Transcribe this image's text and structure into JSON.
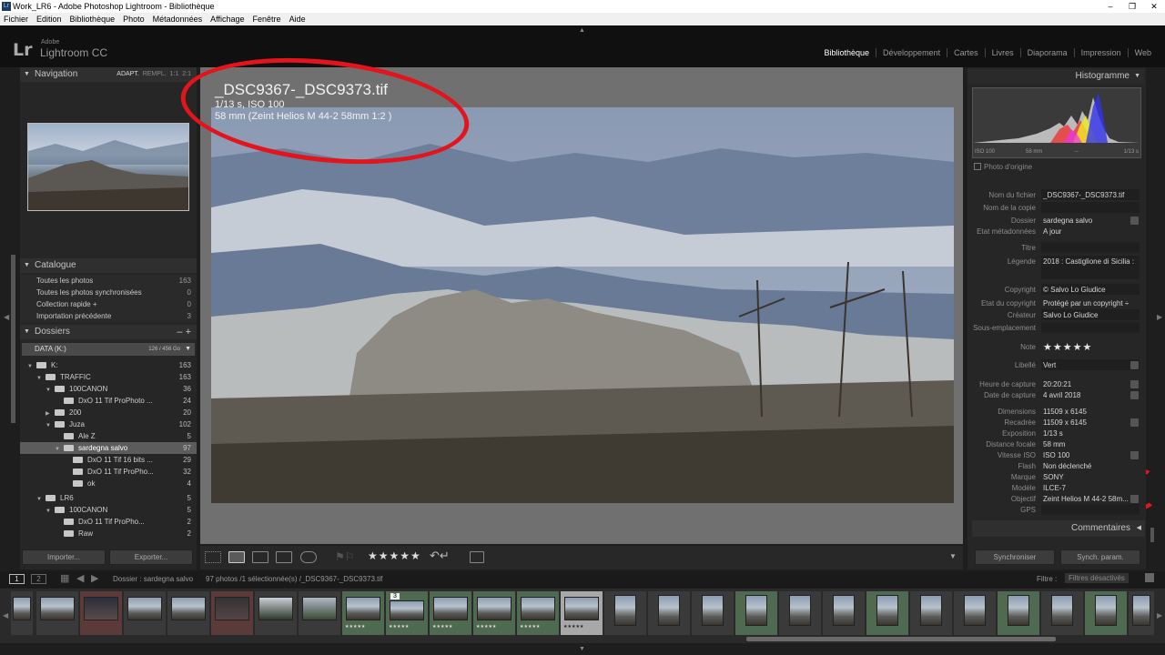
{
  "window": {
    "title": "Work_LR6 - Adobe Photoshop Lightroom - Bibliothèque",
    "controls": [
      "–",
      "❐",
      "✕"
    ]
  },
  "menu": [
    "Fichier",
    "Edition",
    "Bibliothèque",
    "Photo",
    "Métadonnées",
    "Affichage",
    "Fenêtre",
    "Aide"
  ],
  "identity": {
    "logo": "Lr",
    "adobe": "Adobe",
    "product": "Lightroom CC"
  },
  "modules": [
    "Bibliothèque",
    "Développement",
    "Cartes",
    "Livres",
    "Diaporama",
    "Impression",
    "Web"
  ],
  "active_module": "Bibliothèque",
  "navigator": {
    "title": "Navigation",
    "options": [
      "ADAPT.",
      "REMPL.",
      "1:1",
      "2:1"
    ]
  },
  "catalog": {
    "title": "Catalogue",
    "rows": [
      {
        "label": "Toutes les photos",
        "count": "163"
      },
      {
        "label": "Toutes les photos synchronisées",
        "count": "0"
      },
      {
        "label": "Collection rapide +",
        "count": "0"
      },
      {
        "label": "Importation précédente",
        "count": "3"
      }
    ]
  },
  "folders": {
    "title": "Dossiers",
    "volume": {
      "label": "DATA (K:)",
      "size": "126 / 456 Go"
    },
    "items": [
      {
        "label": "K:",
        "count": "163"
      },
      {
        "label": "TRAFFIC",
        "count": "163"
      },
      {
        "label": "100CANON",
        "count": "36"
      },
      {
        "label": "DxO 11 Tif ProPhoto ...",
        "count": "24"
      },
      {
        "label": "200",
        "count": "20"
      },
      {
        "label": "Juza",
        "count": "102"
      },
      {
        "label": "Ale Z",
        "count": "5"
      },
      {
        "label": "sardegna salvo",
        "count": "97"
      },
      {
        "label": "DxO 11 Tif 16 bits ...",
        "count": "29"
      },
      {
        "label": "DxO 11 Tif ProPho...",
        "count": "32"
      },
      {
        "label": "ok",
        "count": "4"
      },
      {
        "label": "LR6",
        "count": "5"
      },
      {
        "label": "100CANON",
        "count": "5"
      },
      {
        "label": "DxO 11 Tif ProPho...",
        "count": "2"
      },
      {
        "label": "Raw",
        "count": "2"
      }
    ]
  },
  "buttons": {
    "import": "Importer...",
    "export": "Exporter...",
    "sync": "Synchroniser",
    "sync_settings": "Synch. param."
  },
  "photo": {
    "filename": "_DSC9367-_DSC9373.tif",
    "exposure": "1/13 s, ISO 100",
    "lens": "58 mm (Zeint Helios M 44-2 58mm 1:2 )"
  },
  "toolbar": {
    "stars": "★★★★★"
  },
  "histogram": {
    "title": "Histogramme",
    "iso": "ISO 100",
    "focal": "58 mm",
    "dash": "--",
    "shutter": "1/13 s",
    "original": "Photo d'origine"
  },
  "metadata": [
    {
      "label": "Nom du fichier",
      "value": "_DSC9367-_DSC9373.tif"
    },
    {
      "label": "Nom de la copie",
      "value": ""
    },
    {
      "label": "Dossier",
      "value": "sardegna salvo"
    },
    {
      "label": "Etat métadonnées",
      "value": "A jour"
    },
    {
      "label": "Titre",
      "value": ""
    },
    {
      "label": "Légende",
      "value": "2018 : Castiglione di Sicilia :"
    },
    {
      "label": "Copyright",
      "value": "© Salvo Lo Giudice"
    },
    {
      "label": "Etat du copyright",
      "value": "Protégé par un copyright ÷"
    },
    {
      "label": "Créateur",
      "value": "Salvo Lo Giudice"
    },
    {
      "label": "Sous-emplacement",
      "value": ""
    },
    {
      "label": "Note",
      "value": "★★★★★"
    },
    {
      "label": "Libellé",
      "value": "Vert"
    },
    {
      "label": "Heure de capture",
      "value": "20:20:21"
    },
    {
      "label": "Date de capture",
      "value": "4 avril 2018"
    },
    {
      "label": "Dimensions",
      "value": "11509 x 6145"
    },
    {
      "label": "Recadrée",
      "value": "11509 x 6145"
    },
    {
      "label": "Exposition",
      "value": "1/13 s"
    },
    {
      "label": "Distance focale",
      "value": "58 mm"
    },
    {
      "label": "Vitesse ISO",
      "value": "ISO 100"
    },
    {
      "label": "Flash",
      "value": "Non déclenché"
    },
    {
      "label": "Marque",
      "value": "SONY"
    },
    {
      "label": "Modèle",
      "value": "ILCE-7"
    },
    {
      "label": "Objectif",
      "value": "Zeint Helios M 44-2 58m..."
    },
    {
      "label": "GPS",
      "value": ""
    }
  ],
  "comments": "Commentaires",
  "filmstrip": {
    "page1": "1",
    "page2": "2",
    "source": "Dossier : sardegna salvo",
    "count": "97 photos /1 sélectionnée(s) /_DSC9367-_DSC9373.tif",
    "filter_label": "Filtre :",
    "filter_value": "Filtres désactivés",
    "badge": "3",
    "thumb_stars": "★★★★★"
  }
}
